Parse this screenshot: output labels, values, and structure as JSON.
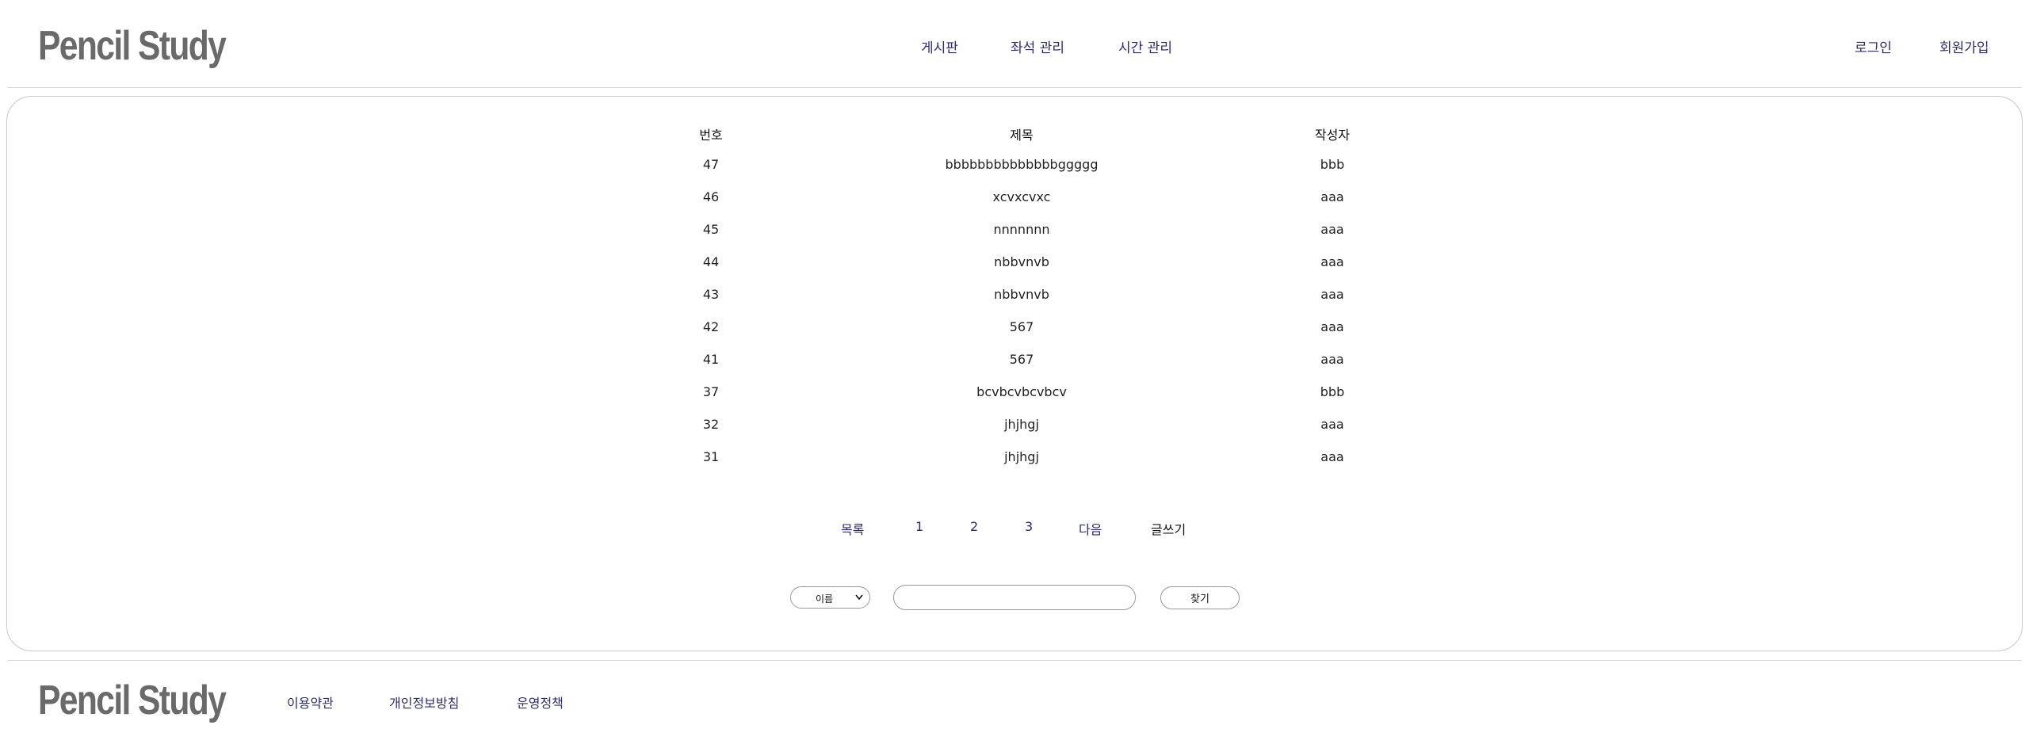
{
  "header": {
    "logo": "Pencil Study",
    "nav": {
      "board": "게시판",
      "seat": "좌석 관리",
      "time": "시간 관리"
    },
    "auth": {
      "login": "로그인",
      "signup": "회원가입"
    }
  },
  "board": {
    "columns": {
      "no": "번호",
      "title": "제목",
      "author": "작성자"
    },
    "rows": [
      {
        "no": "47",
        "title": "bbbbbbbbbbbbbbggggg",
        "author": "bbb"
      },
      {
        "no": "46",
        "title": "xcvxcvxc",
        "author": "aaa"
      },
      {
        "no": "45",
        "title": "nnnnnnn",
        "author": "aaa"
      },
      {
        "no": "44",
        "title": "nbbvnvb",
        "author": "aaa"
      },
      {
        "no": "43",
        "title": "nbbvnvb",
        "author": "aaa"
      },
      {
        "no": "42",
        "title": "567",
        "author": "aaa"
      },
      {
        "no": "41",
        "title": "567",
        "author": "aaa"
      },
      {
        "no": "37",
        "title": "bcvbcvbcvbcv",
        "author": "bbb"
      },
      {
        "no": "32",
        "title": "jhjhgj",
        "author": "aaa"
      },
      {
        "no": "31",
        "title": "jhjhgj",
        "author": "aaa"
      }
    ]
  },
  "pagination": {
    "list": "목록",
    "pages": [
      "1",
      "2",
      "3"
    ],
    "next": "다음",
    "write": "글쓰기"
  },
  "search": {
    "selected_option": "이름",
    "input_value": "",
    "button_label": "찾기"
  },
  "footer": {
    "logo": "Pencil Study",
    "links": {
      "terms": "이용약관",
      "privacy": "개인정보방침",
      "policy": "운영정책"
    }
  },
  "colors": {
    "link": "#2c2a7a",
    "logo": "#6a6a6a",
    "border": "#c8c8c8"
  }
}
